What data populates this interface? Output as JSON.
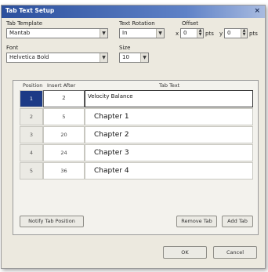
{
  "window": {
    "title": "Tab Text Setup",
    "close_glyph": "×"
  },
  "labels": {
    "tab_template": "Tab Template",
    "text_rotation": "Text Rotation",
    "offset": "Offset",
    "font": "Font",
    "size": "Size",
    "offset_x": "x",
    "offset_y": "y",
    "unit_x": "pts",
    "unit_y": "pts"
  },
  "fields": {
    "tab_template": "Mantab",
    "text_rotation": "In",
    "offset_x": "0",
    "offset_y": "0",
    "font": "Helvetica Bold",
    "size": "10"
  },
  "table": {
    "headers": [
      "Position",
      "Insert After",
      "Tab Text"
    ],
    "rows": [
      {
        "position": "1",
        "insert_after": "2",
        "tab_text": "Velocity Balance"
      },
      {
        "position": "2",
        "insert_after": "5",
        "tab_text": "Chapter 1"
      },
      {
        "position": "3",
        "insert_after": "20",
        "tab_text": "Chapter 2"
      },
      {
        "position": "4",
        "insert_after": "24",
        "tab_text": "Chapter 3"
      },
      {
        "position": "5",
        "insert_after": "36",
        "tab_text": "Chapter 4"
      }
    ]
  },
  "buttons": {
    "notify": "Notify Tab Position",
    "remove": "Remove Tab",
    "add": "Add Tab",
    "ok": "OK",
    "cancel": "Cancel"
  },
  "icons": {
    "dropdown": "▼",
    "spin_up": "▲",
    "spin_down": "▼"
  }
}
